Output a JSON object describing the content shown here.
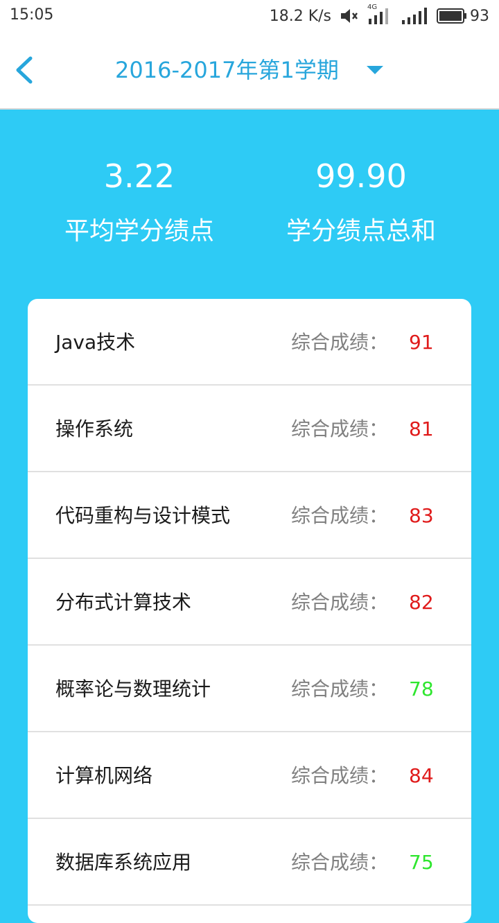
{
  "status_bar": {
    "time": "15:05",
    "network_speed": "18.2 K/s",
    "network_type": "4G",
    "battery": "93",
    "icons": [
      "mute-icon",
      "signal-4g-icon",
      "signal-icon",
      "battery-icon"
    ]
  },
  "header": {
    "title": "2016-2017年第1学期",
    "back_icon": "chevron-left-icon",
    "dropdown_icon": "caret-down-icon"
  },
  "summary": {
    "gpa_value": "3.22",
    "gpa_label": "平均学分绩点",
    "total_value": "99.90",
    "total_label": "学分绩点总和"
  },
  "courses": [
    {
      "name": "Java技术",
      "score_label": "综合成绩：",
      "score": "91",
      "score_color": "#e01b1b"
    },
    {
      "name": "操作系统",
      "score_label": "综合成绩：",
      "score": "81",
      "score_color": "#e01b1b"
    },
    {
      "name": "代码重构与设计模式",
      "score_label": "综合成绩：",
      "score": "83",
      "score_color": "#e01b1b"
    },
    {
      "name": "分布式计算技术",
      "score_label": "综合成绩：",
      "score": "82",
      "score_color": "#e01b1b"
    },
    {
      "name": "概率论与数理统计",
      "score_label": "综合成绩：",
      "score": "78",
      "score_color": "#2ee62e"
    },
    {
      "name": "计算机网络",
      "score_label": "综合成绩：",
      "score": "84",
      "score_color": "#e01b1b"
    },
    {
      "name": "数据库系统应用",
      "score_label": "综合成绩：",
      "score": "75",
      "score_color": "#2ee62e"
    }
  ],
  "colors": {
    "accent": "#2ecbf5",
    "title_blue": "#27a6dc",
    "high_score": "#e01b1b",
    "low_score": "#2ee62e"
  }
}
